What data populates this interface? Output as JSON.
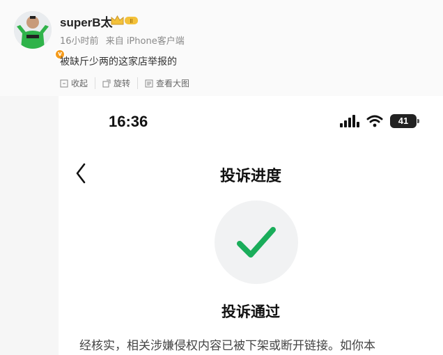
{
  "post": {
    "username": "superB太",
    "badge_text": "II",
    "time": "16小时前",
    "source": "来自 iPhone客户端",
    "text": "被缺斤少两的这家店举报的",
    "actions": [
      {
        "icon": "collapse-icon",
        "label": "收起"
      },
      {
        "icon": "rotate-icon",
        "label": "旋转"
      },
      {
        "icon": "view-large-icon",
        "label": "查看大图"
      }
    ]
  },
  "phone": {
    "time": "16:36",
    "battery": "41",
    "nav_title": "投诉进度",
    "result_title": "投诉通过",
    "result_desc": "经核实，相关涉嫌侵权内容已被下架或断开链接。如你本"
  },
  "colors": {
    "check_green": "#1aad5a",
    "avatar_shirt": "#2fb34a",
    "verified": "#f59b1b",
    "badge_gold": "#f3c13a"
  }
}
